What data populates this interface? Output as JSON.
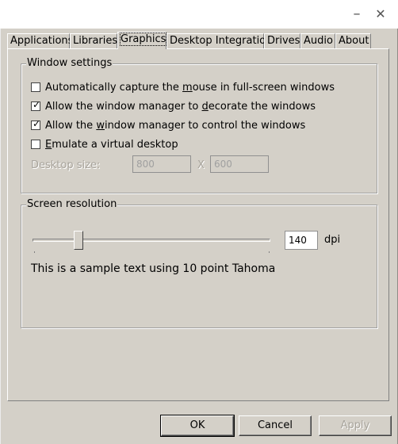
{
  "titlebar": {
    "minimize_glyph": "–",
    "close_glyph": "✕"
  },
  "tabs": [
    {
      "label": "Applications"
    },
    {
      "label": "Libraries"
    },
    {
      "label": "Graphics",
      "active": true
    },
    {
      "label": "Desktop Integration"
    },
    {
      "label": "Drives"
    },
    {
      "label": "Audio"
    },
    {
      "label": "About"
    }
  ],
  "window_settings": {
    "title": "Window settings",
    "options": [
      {
        "pre": "Automatically capture the ",
        "u": "m",
        "post": "ouse in full-screen windows",
        "checked": false
      },
      {
        "pre": "Allow the window manager to ",
        "u": "d",
        "post": "ecorate the windows",
        "checked": true
      },
      {
        "pre": "Allow the ",
        "u": "w",
        "post": "indow manager to control the windows",
        "checked": true
      },
      {
        "pre": "",
        "u": "E",
        "post": "mulate a virtual desktop",
        "checked": false
      }
    ],
    "desktop_size": {
      "label": "Desktop size:",
      "width": "800",
      "separator": "X",
      "height": "600"
    }
  },
  "screen_resolution": {
    "title": "Screen resolution",
    "dpi_value": "140",
    "dpi_unit": "dpi",
    "sample_text": "This is a sample text using 10 point Tahoma"
  },
  "buttons": {
    "ok": "OK",
    "cancel": "Cancel",
    "apply": "Apply"
  },
  "colors": {
    "dialog_bg": "#d4d0c8",
    "disabled_text": "#a8a49c"
  }
}
